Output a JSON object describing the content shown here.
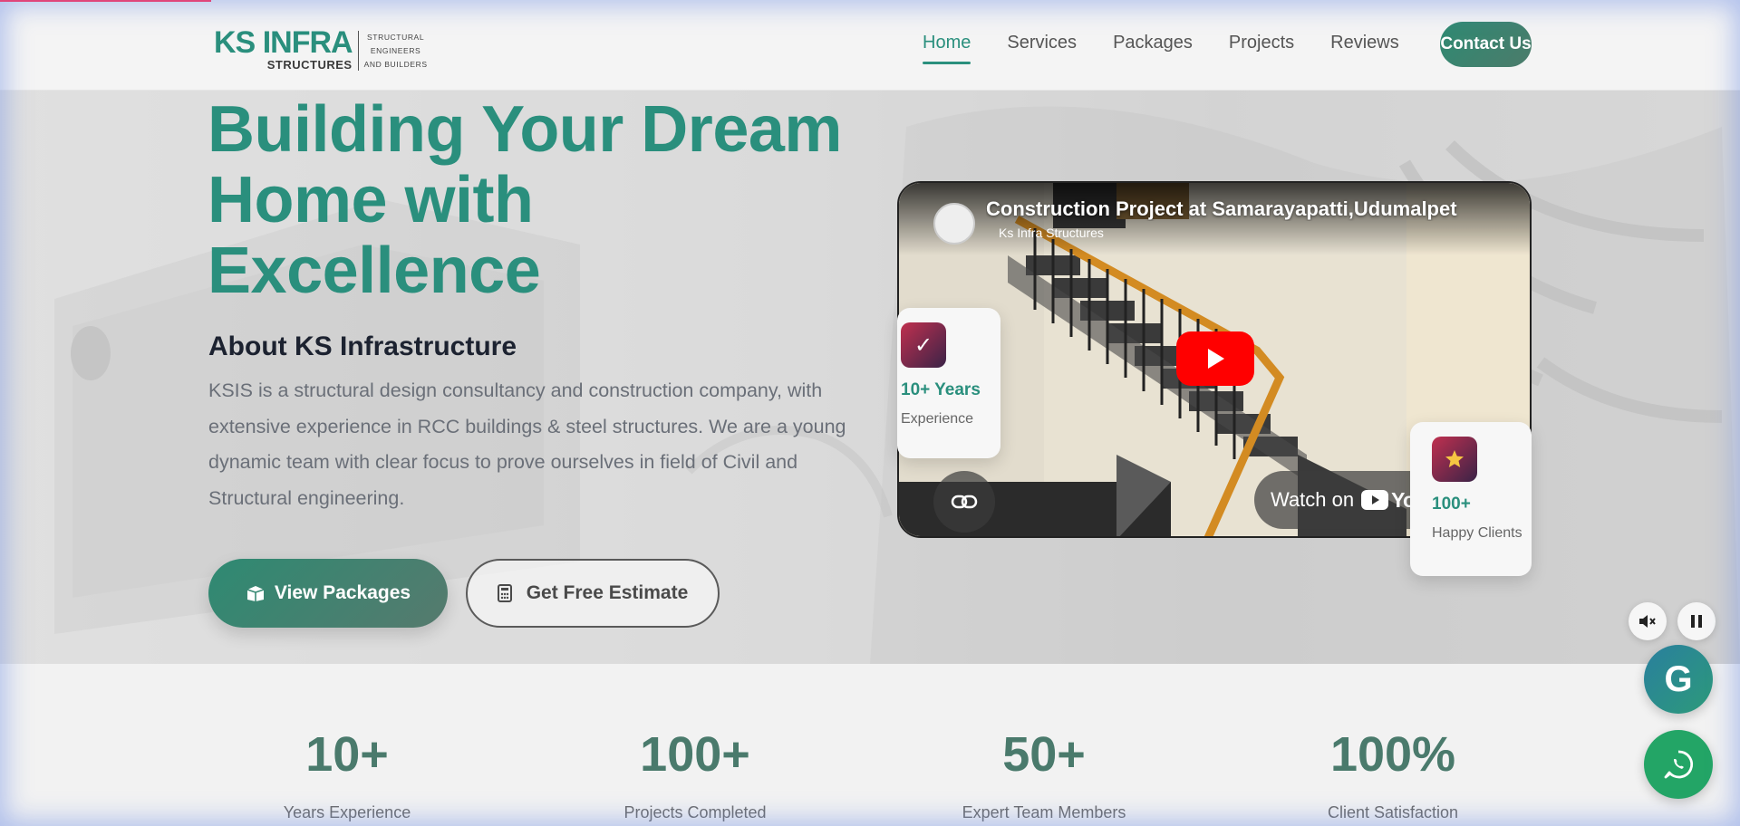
{
  "brand": {
    "logo_top_ks": "KS",
    "logo_top_infra": "INFRA",
    "logo_bottom": "STRUCTURES",
    "logo_side_lines": [
      "STRUCTURAL",
      "ENGINEERS",
      "AND BUILDERS"
    ],
    "accent_color": "#2a8f7d"
  },
  "nav": {
    "items": [
      {
        "label": "Home",
        "active": true
      },
      {
        "label": "Services"
      },
      {
        "label": "Packages"
      },
      {
        "label": "Projects"
      },
      {
        "label": "Reviews"
      }
    ],
    "contact_label": "Contact Us"
  },
  "hero": {
    "title_lines": [
      "Building Your Dream",
      "Home with",
      "Excellence"
    ],
    "about_title": "About KS Infrastructure",
    "about_text": "KSIS is a structural design consultancy and construction company, with extensive experience in RCC buildings & steel structures. We are a young dynamic team with clear focus to prove ourselves in field of Civil and Structural engineering.",
    "btn_packages": "View Packages",
    "btn_estimate": "Get Free Estimate"
  },
  "video": {
    "title": "Construction Project at Samarayapatti,Udumalpet",
    "channel": "Ks Infra Structures",
    "watch_label": "Watch on",
    "youtube_label": "YouTube"
  },
  "cards": {
    "years_value": "10+ Years",
    "years_label": "Experience",
    "clients_value": "100+",
    "clients_label": "Happy Clients"
  },
  "stats": [
    {
      "value": "10+",
      "label": "Years Experience"
    },
    {
      "value": "100+",
      "label": "Projects Completed"
    },
    {
      "value": "50+",
      "label": "Expert Team Members"
    },
    {
      "value": "100%",
      "label": "Client Satisfaction"
    }
  ],
  "floating": {
    "g_letter": "G"
  }
}
